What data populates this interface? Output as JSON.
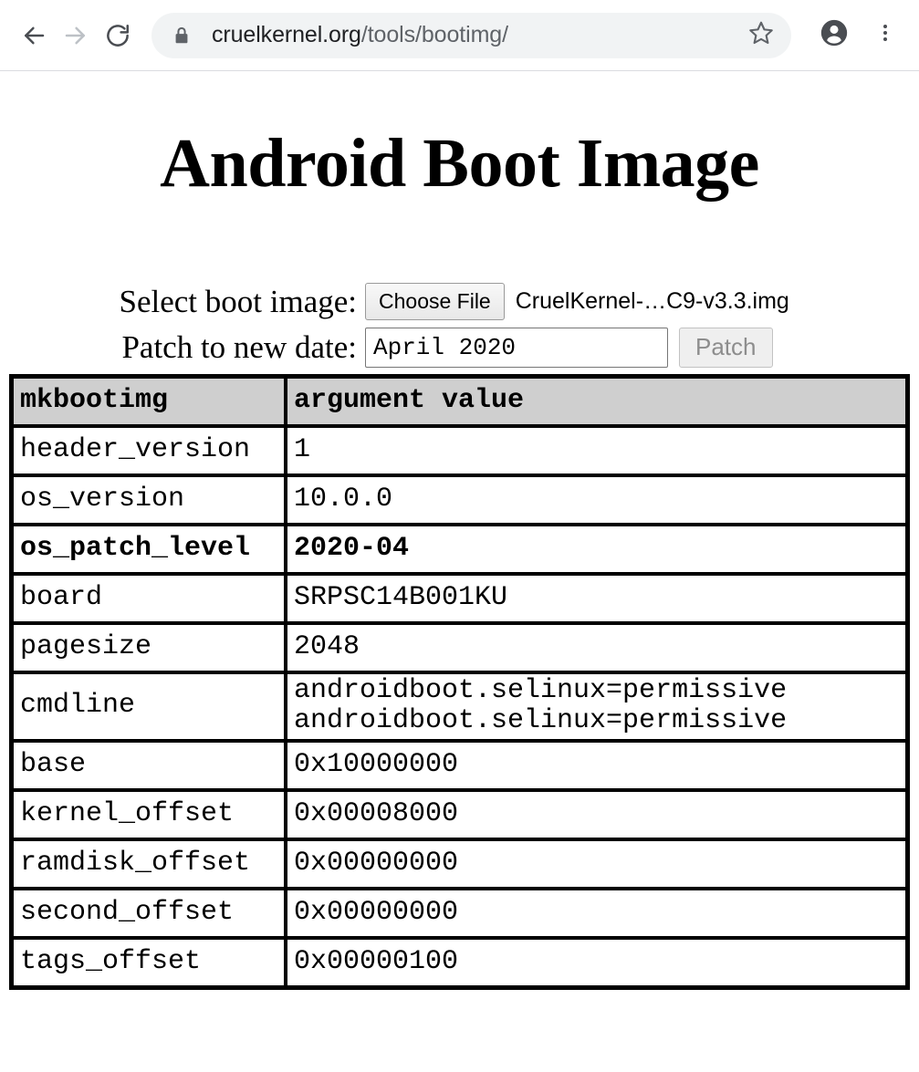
{
  "browser": {
    "back_icon": "back-arrow-icon",
    "forward_icon": "forward-arrow-icon",
    "reload_icon": "reload-icon",
    "lock_icon": "lock-icon",
    "url_domain": "cruelkernel.org",
    "url_path": "/tools/bootimg/",
    "star_icon": "star-icon",
    "profile_icon": "profile-avatar-icon",
    "menu_icon": "kebab-menu-icon"
  },
  "page": {
    "title": "Android Boot Image"
  },
  "form": {
    "file_label": "Select boot image:",
    "choose_file_button": "Choose File",
    "file_name": "CruelKernel-…C9-v3.3.img",
    "date_label": "Patch to new date:",
    "date_value": "April 2020",
    "date_placeholder": "April 2020",
    "patch_button": "Patch"
  },
  "table": {
    "headers": [
      "mkbootimg",
      "argument value"
    ],
    "rows": [
      {
        "key": "header_version",
        "value": "1",
        "highlight": false
      },
      {
        "key": "os_version",
        "value": "10.0.0",
        "highlight": false
      },
      {
        "key": "os_patch_level",
        "value": "2020-04",
        "highlight": true
      },
      {
        "key": "board",
        "value": "SRPSC14B001KU",
        "highlight": false
      },
      {
        "key": "pagesize",
        "value": "2048",
        "highlight": false
      },
      {
        "key": "cmdline",
        "value": "androidboot.selinux=permissive\nandroidboot.selinux=permissive",
        "highlight": false
      },
      {
        "key": "base",
        "value": "0x10000000",
        "highlight": false
      },
      {
        "key": "kernel_offset",
        "value": "0x00008000",
        "highlight": false
      },
      {
        "key": "ramdisk_offset",
        "value": "0x00000000",
        "highlight": false
      },
      {
        "key": "second_offset",
        "value": "0x00000000",
        "highlight": false
      },
      {
        "key": "tags_offset",
        "value": "0x00000100",
        "highlight": false
      }
    ]
  },
  "colors": {
    "header_bg": "#cfcfcf",
    "omnibox_bg": "#f1f3f4",
    "url_path_text": "#5f6368",
    "disabled_text": "#8d8d8d"
  }
}
